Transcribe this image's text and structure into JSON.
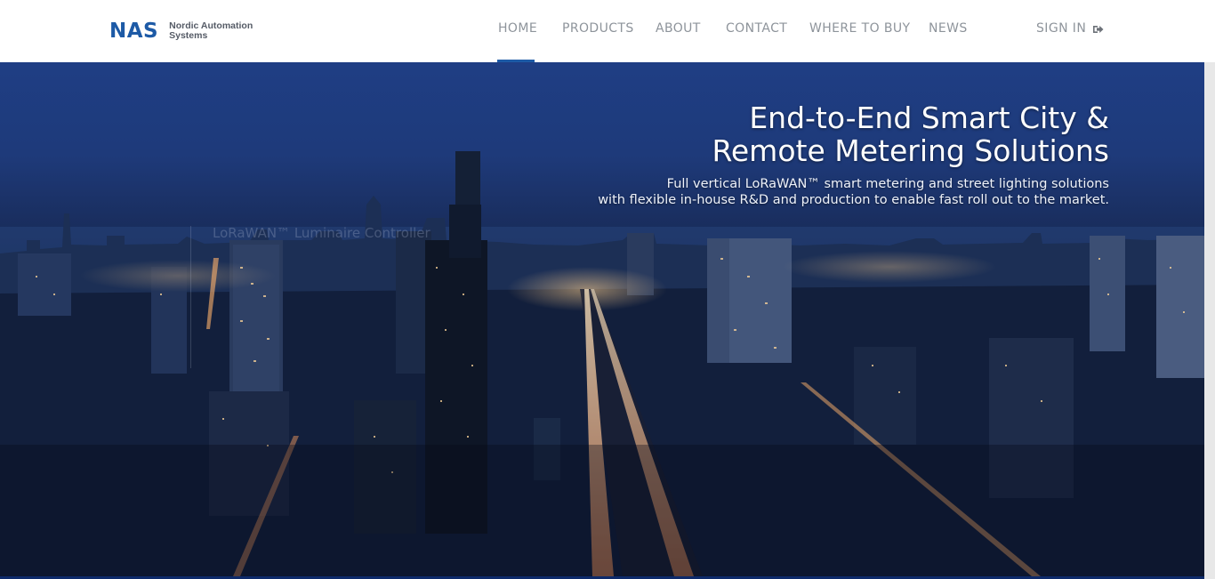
{
  "brand": {
    "mark": "NAS",
    "name_line1": "Nordic Automation",
    "name_line2": "Systems"
  },
  "nav": {
    "items": [
      {
        "label": "HOME",
        "active": true
      },
      {
        "label": "PRODUCTS",
        "active": false
      },
      {
        "label": "ABOUT",
        "active": false
      },
      {
        "label": "CONTACT",
        "active": false
      },
      {
        "label": "WHERE TO BUY",
        "active": false
      },
      {
        "label": "NEWS",
        "active": false
      }
    ],
    "signin_label": "SIGN IN",
    "signin_icon": "sign-in-icon"
  },
  "hero": {
    "title_line1": "End-to-End Smart City &",
    "title_line2": "Remote Metering Solutions",
    "subtitle_line1": "Full vertical LoRaWAN™ smart metering and street lighting solutions",
    "subtitle_line2": "with flexible in-house R&D and production to enable fast roll out to the market.",
    "ghost_caption": "LoRaWAN™ Luminaire Controller"
  },
  "colors": {
    "brand_blue": "#1d5aa6",
    "nav_text": "#8e949b",
    "hero_sky": "#1f3e84"
  }
}
